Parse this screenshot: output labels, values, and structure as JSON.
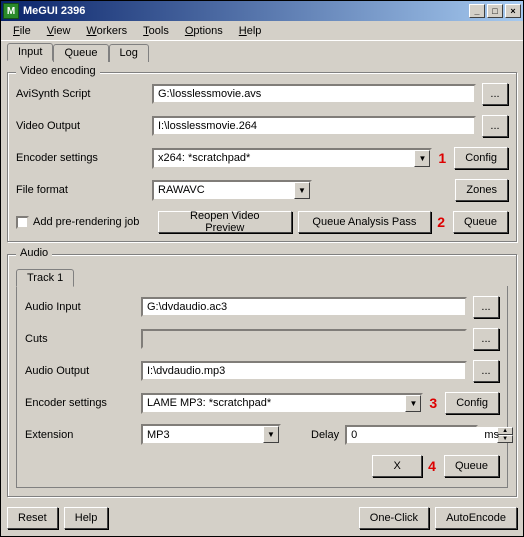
{
  "window": {
    "title": "MeGUI 2396",
    "appicon_letter": "M"
  },
  "menu": [
    "File",
    "View",
    "Workers",
    "Tools",
    "Options",
    "Help"
  ],
  "main_tabs": [
    "Input",
    "Queue",
    "Log"
  ],
  "video": {
    "legend": "Video encoding",
    "avisynth_label": "AviSynth Script",
    "avisynth_value": "G:\\losslessmovie.avs",
    "output_label": "Video Output",
    "output_value": "I:\\losslessmovie.264",
    "encoder_label": "Encoder settings",
    "encoder_value": "x264: *scratchpad*",
    "config_label": "Config",
    "fileformat_label": "File format",
    "fileformat_value": "RAWAVC",
    "zones_label": "Zones",
    "addprerender_label": "Add pre-rendering job",
    "reopen_label": "Reopen Video Preview",
    "queue_analysis_label": "Queue Analysis Pass",
    "queue_label": "Queue"
  },
  "audio": {
    "legend": "Audio",
    "track_tabs": [
      "Track 1"
    ],
    "input_label": "Audio Input",
    "input_value": "G:\\dvdaudio.ac3",
    "cuts_label": "Cuts",
    "cuts_value": "",
    "output_label": "Audio Output",
    "output_value": "I:\\dvdaudio.mp3",
    "encoder_label": "Encoder settings",
    "encoder_value": "LAME MP3: *scratchpad*",
    "config_label": "Config",
    "extension_label": "Extension",
    "extension_value": "MP3",
    "delay_label": "Delay",
    "delay_value": "0",
    "delay_unit": "ms",
    "x_label": "X",
    "queue_label": "Queue"
  },
  "bottom": {
    "reset": "Reset",
    "help": "Help",
    "oneclick": "One-Click",
    "autoencode": "AutoEncode"
  },
  "marks": {
    "m1": "1",
    "m2": "2",
    "m3": "3",
    "m4": "4"
  }
}
